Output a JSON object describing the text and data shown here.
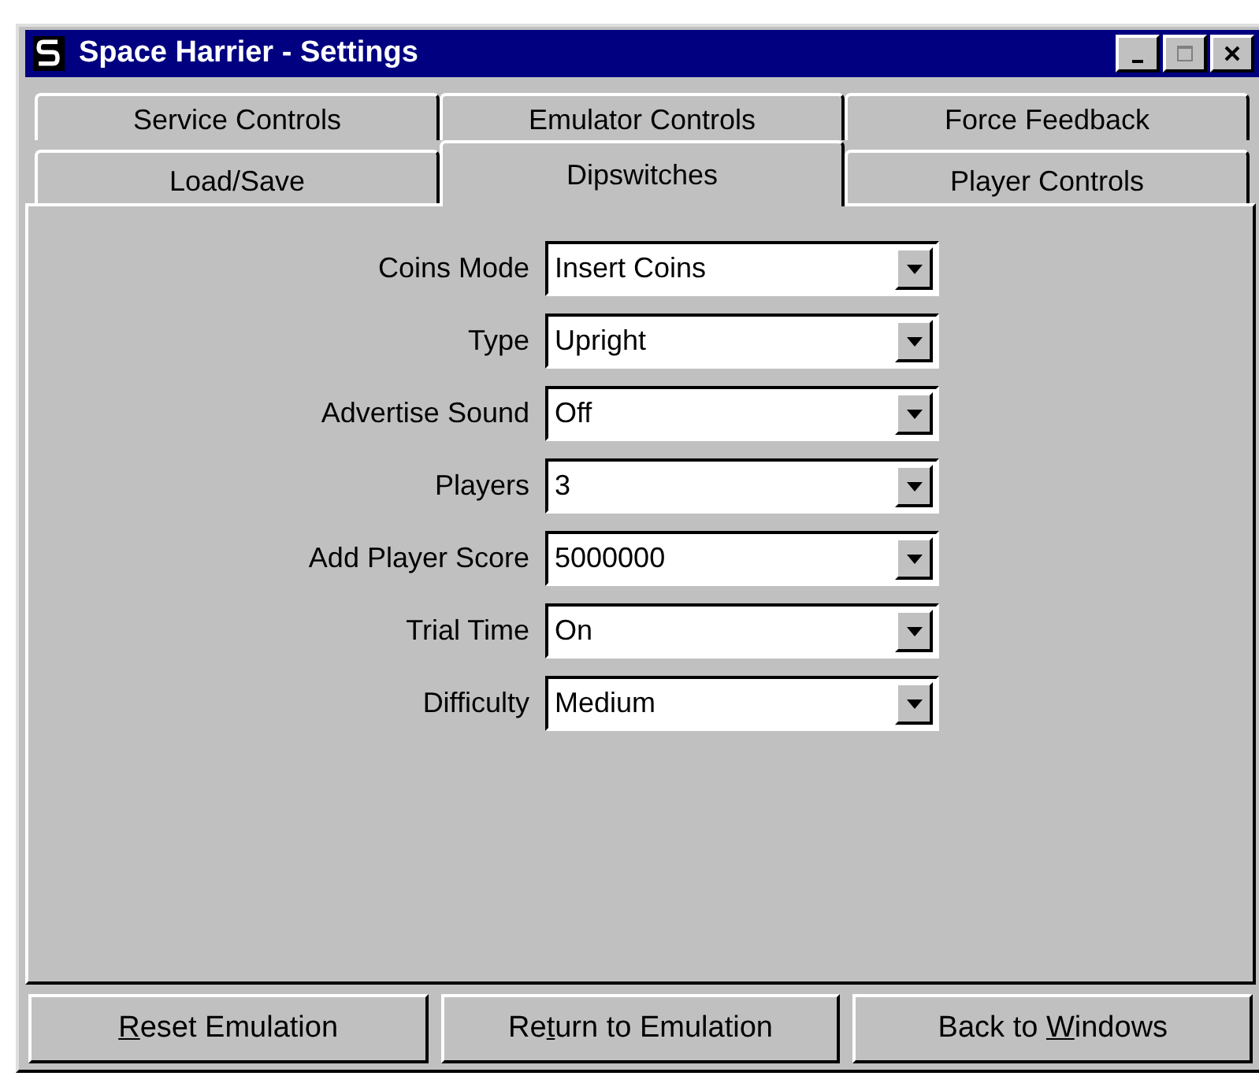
{
  "window": {
    "title": "Space Harrier - Settings"
  },
  "tab_rows": [
    [
      {
        "label": "Service Controls",
        "selected": false
      },
      {
        "label": "Emulator Controls",
        "selected": false
      },
      {
        "label": "Force Feedback",
        "selected": false
      }
    ],
    [
      {
        "label": "Load/Save",
        "selected": false
      },
      {
        "label": "Dipswitches",
        "selected": true
      },
      {
        "label": "Player Controls",
        "selected": false
      }
    ]
  ],
  "settings": [
    {
      "label": "Coins Mode",
      "value": "Insert Coins"
    },
    {
      "label": "Type",
      "value": "Upright"
    },
    {
      "label": "Advertise Sound",
      "value": "Off"
    },
    {
      "label": "Players",
      "value": "3"
    },
    {
      "label": "Add Player Score",
      "value": "5000000"
    },
    {
      "label": "Trial Time",
      "value": "On"
    },
    {
      "label": "Difficulty",
      "value": "Medium"
    }
  ],
  "buttons": [
    {
      "key": "R",
      "post": "eset Emulation"
    },
    {
      "pre": "Re",
      "key": "t",
      "post": "urn to Emulation"
    },
    {
      "pre": "Back to ",
      "key": "W",
      "post": "indows"
    }
  ]
}
